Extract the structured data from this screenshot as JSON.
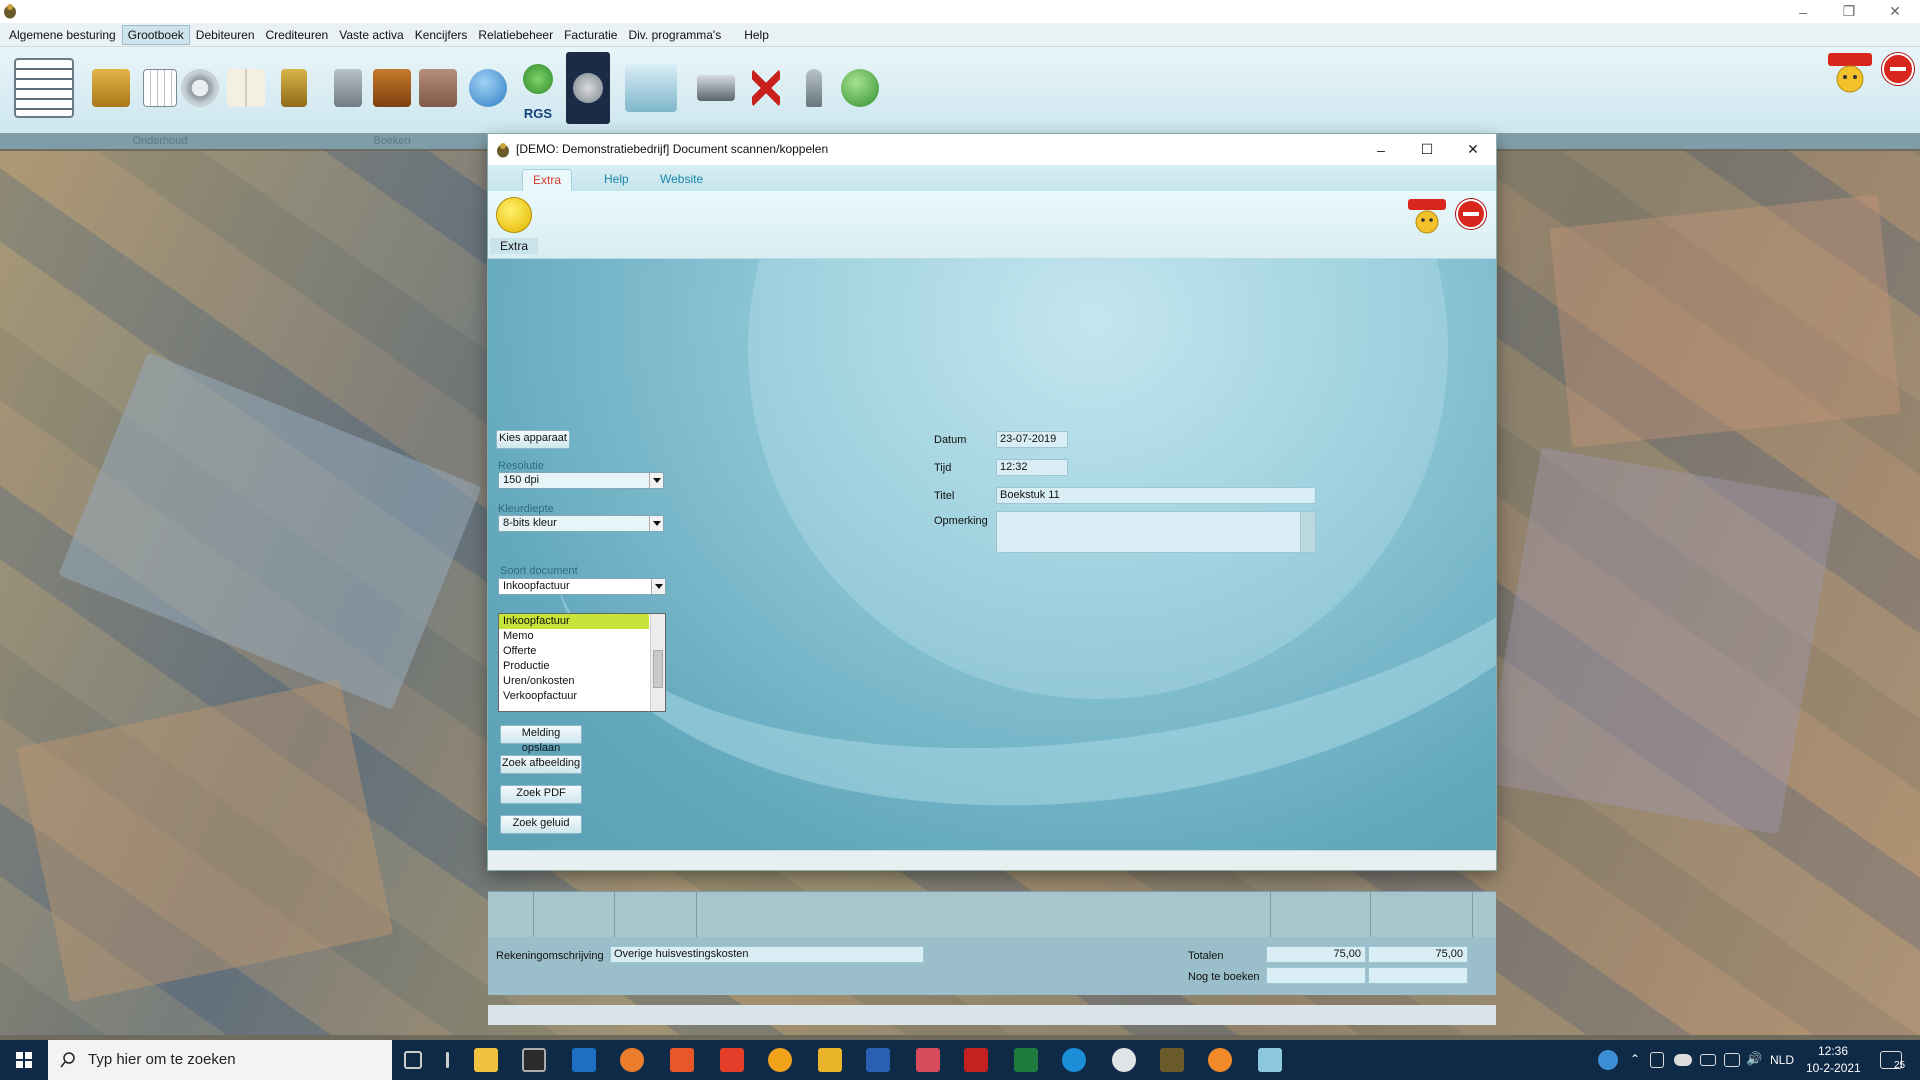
{
  "menu": [
    "Algemene besturing",
    "Grootboek",
    "Debiteuren",
    "Crediteuren",
    "Vaste activa",
    "Kencijfers",
    "Relatiebeheer",
    "Facturatie",
    "Div. programma's",
    "Help"
  ],
  "ribbon": {
    "groups": [
      "Onderhoud",
      "Boeken"
    ],
    "rgs_label": "RGS"
  },
  "dialog": {
    "title": "[DEMO: Demonstratiebedrijf]  Document scannen/koppelen",
    "tabs": [
      "Extra",
      "Help",
      "Website"
    ],
    "extra_label": "Extra",
    "kies_apparaat": "Kies apparaat",
    "resolutie_label": "Resolutie",
    "resolutie_value": "150 dpi",
    "kleurdiepte_label": "Kleurdiepte",
    "kleurdiepte_value": "8-bits kleur",
    "soort_label": "Soort document",
    "soort_value": "Inkoopfactuur",
    "soort_options": [
      "Inkoopfactuur",
      "Memo",
      "Offerte",
      "Productie",
      "Uren/onkosten",
      "Verkoopfactuur"
    ],
    "buttons": [
      "Melding opslaan",
      "Zoek afbeelding",
      "Zoek PDF",
      "Zoek geluid"
    ],
    "datum_label": "Datum",
    "datum_value": "23-07-2019",
    "tijd_label": "Tijd",
    "tijd_value": "12:32",
    "titel_label": "Titel",
    "titel_value": "Boekstuk 11",
    "opmerking_label": "Opmerking",
    "opmerking_value": ""
  },
  "lower": {
    "rekening_label": "Rekeningomschrijving",
    "rekening_value": "Overige huisvestingskosten",
    "totalen_label": "Totalen",
    "totalen_1": "75,00",
    "totalen_2": "75,00",
    "nog_label": "Nog te boeken"
  },
  "taskbar": {
    "search_placeholder": "Typ hier om te zoeken",
    "lang": "NLD",
    "time": "12:36",
    "date": "10-2-2021",
    "notif_count": "25"
  },
  "colors": {
    "accent_tab": "#d23b2e",
    "selected_item": "#c6e43a",
    "taskbar": "#0f2a47"
  }
}
